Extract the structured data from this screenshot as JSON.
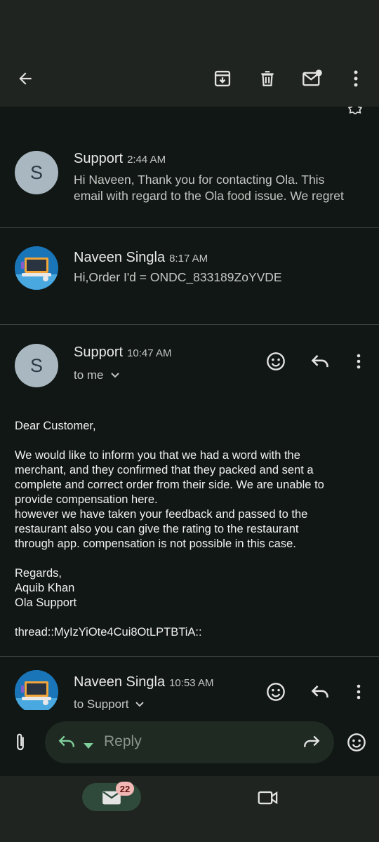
{
  "thread": {
    "messages": [
      {
        "avatar_letter": "S",
        "sender": "Support",
        "time": "2:44 AM",
        "snippet_line1": "Hi Naveen, Thank you for contacting Ola. This",
        "snippet_line2": "email with regard to the Ola food issue. We regret"
      },
      {
        "sender": "Naveen Singla",
        "time": "8:17 AM",
        "snippet_line1": "Hi,Order I'd = ONDC_833189ZoYVDE"
      },
      {
        "avatar_letter": "S",
        "sender": "Support",
        "time": "10:47 AM",
        "recipient": "to me",
        "body": {
          "greeting": "Dear Customer,",
          "para1": "We would like to inform you that we had a word with the\nmerchant, and they confirmed that they packed and sent a\ncomplete and correct order from their side. We are unable to\nprovide compensation here.\nhowever we have taken your feedback and passed to the\nrestaurant also you can give the rating to the restaurant\nthrough app. compensation is not possible in this case.",
          "signoff": "Regards,\nAquib Khan\nOla Support",
          "thread_id": "thread::MyIzYiOte4Cui8OtLPTBTiA::"
        }
      },
      {
        "sender": "Naveen Singla",
        "time": "10:53 AM",
        "recipient": "to Support"
      }
    ]
  },
  "composer": {
    "reply_placeholder": "Reply"
  },
  "navbar": {
    "mail_badge": "22"
  },
  "colors": {
    "background": "#111714",
    "bar": "#1f2420",
    "accent_green": "#7fcf9a",
    "badge": "#f2b8b5"
  }
}
